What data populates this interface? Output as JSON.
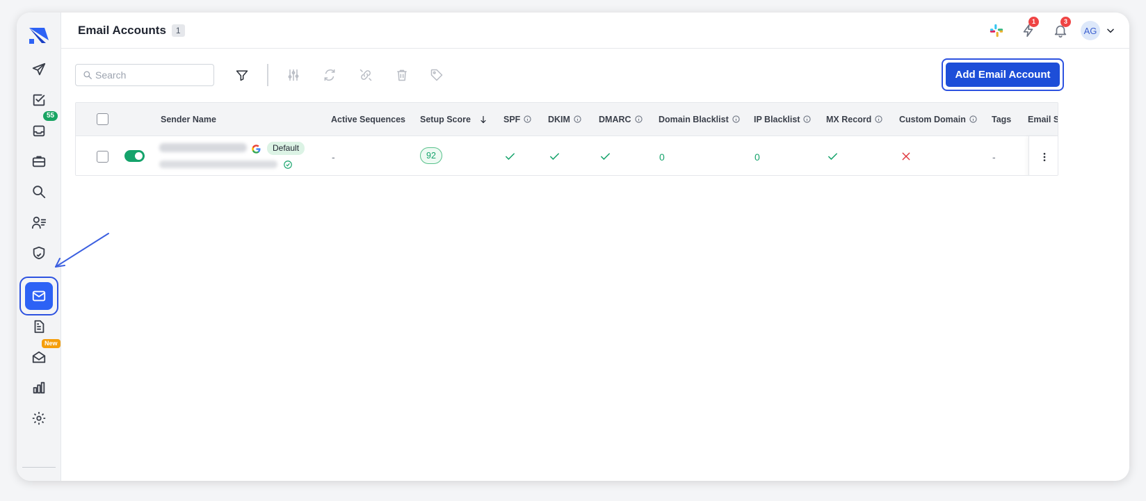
{
  "header": {
    "title": "Email Accounts",
    "count": "1",
    "lightning_badge": "1",
    "notifications_badge": "3",
    "avatar_initials": "AG"
  },
  "sidebar": {
    "inbox_badge": "55",
    "new_badge": "New",
    "items": [
      {
        "name": "sequences",
        "icon": "paper-plane-icon"
      },
      {
        "name": "tasks",
        "icon": "checkbox-icon"
      },
      {
        "name": "inbox",
        "icon": "inbox-icon"
      },
      {
        "name": "deals",
        "icon": "briefcase-icon"
      },
      {
        "name": "prospect-search",
        "icon": "search-icon"
      },
      {
        "name": "prospects",
        "icon": "user-list-icon"
      },
      {
        "name": "security",
        "icon": "shield-check-icon"
      },
      {
        "name": "email-accounts",
        "icon": "mail-icon",
        "active": true
      },
      {
        "name": "templates",
        "icon": "document-icon"
      },
      {
        "name": "email-warmup",
        "icon": "mail-open-icon"
      },
      {
        "name": "reports",
        "icon": "bar-chart-icon"
      },
      {
        "name": "settings",
        "icon": "gear-icon"
      }
    ]
  },
  "toolbar": {
    "search_placeholder": "Search",
    "add_button_label": "Add Email Account"
  },
  "table": {
    "columns": [
      "Sender Name",
      "Active Sequences",
      "Setup Score",
      "SPF",
      "DKIM",
      "DMARC",
      "Domain Blacklist",
      "IP Blacklist",
      "MX Record",
      "Custom Domain",
      "Tags",
      "Email Se"
    ],
    "rows": [
      {
        "default_label": "Default",
        "active_sequences": "-",
        "setup_score": "92",
        "spf": "pass",
        "dkim": "pass",
        "dmarc": "pass",
        "domain_blacklist": "0",
        "ip_blacklist": "0",
        "mx_record": "pass",
        "custom_domain": "fail",
        "tags": "-"
      }
    ]
  },
  "colors": {
    "primary": "#1d4ed8",
    "active_nav": "#2d62f5",
    "success": "#15a36b",
    "danger": "#e0383e",
    "warning": "#f59e0b"
  }
}
